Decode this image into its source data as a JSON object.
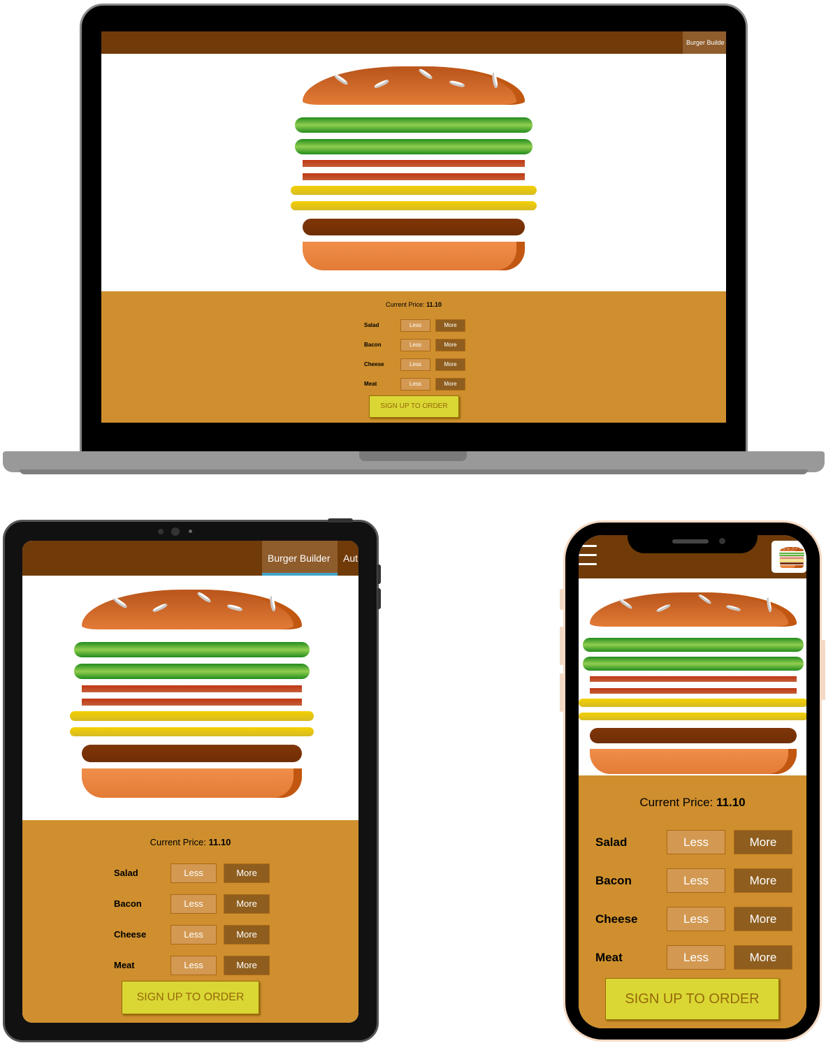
{
  "app": {
    "nav_items": [
      "Burger Builder",
      "Authenticate"
    ],
    "nav_item_truncated_laptop": "Burger Builde",
    "nav_item_truncated_tablet_2": "Aut",
    "price_label": "Current Price:",
    "price_value": "11.10",
    "ingredients": [
      {
        "label": "Salad",
        "less": "Less",
        "more": "More"
      },
      {
        "label": "Bacon",
        "less": "Less",
        "more": "More"
      },
      {
        "label": "Cheese",
        "less": "Less",
        "more": "More"
      },
      {
        "label": "Meat",
        "less": "Less",
        "more": "More"
      }
    ],
    "order_button": "SIGN UP TO ORDER"
  },
  "devices": [
    "laptop",
    "tablet",
    "phone"
  ],
  "colors": {
    "navbar": "#703b09",
    "controls_bg": "#cf8f2e",
    "less_button": "#d39952",
    "more_button": "#8f5e1e",
    "order_button": "#dad735"
  },
  "icons": [
    "hamburger-menu-icon",
    "burger-logo-icon"
  ]
}
